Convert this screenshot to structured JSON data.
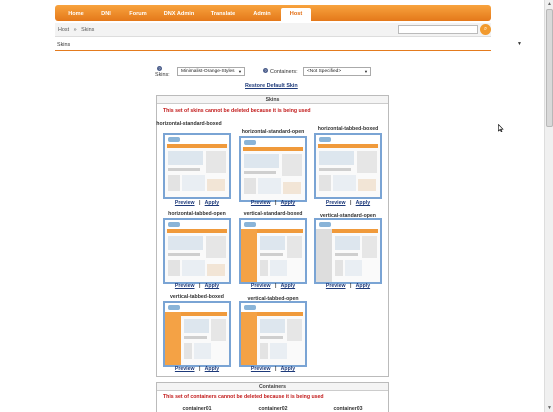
{
  "nav": {
    "tabs": [
      {
        "label": "Home"
      },
      {
        "label": "DNI"
      },
      {
        "label": "Forum"
      },
      {
        "label": "DNX Admin"
      },
      {
        "label": "Translate"
      },
      {
        "label": "Admin"
      },
      {
        "label": "Host",
        "active": true
      }
    ]
  },
  "breadcrumb": {
    "root": "Host",
    "separator": "»",
    "current": "Skins"
  },
  "search": {
    "value": "",
    "icon": "search-icon"
  },
  "module": {
    "title": "Skins",
    "collapse_icon": "chevron-down-icon"
  },
  "skins_selector": {
    "label": "Skins:",
    "value": "Minimalist-Orange-Styles",
    "help_icon": "help-icon"
  },
  "containers_selector": {
    "label": "Containers:",
    "value": "<Not Specified>",
    "help_icon": "help-icon"
  },
  "restore_label": "Restore Default Skin",
  "skins_panel": {
    "header": "Skins",
    "warning": "This set of skins cannot be deleted because it is being used",
    "items": [
      {
        "title": "horizontal-standard-boxed",
        "preview": "Preview",
        "apply": "Apply"
      },
      {
        "title": "horizontal-standard-open",
        "preview": "Preview",
        "apply": "Apply"
      },
      {
        "title": "horizontal-tabbed-boxed",
        "preview": "Preview",
        "apply": "Apply"
      },
      {
        "title": "horizontal-tabbed-open",
        "preview": "Preview",
        "apply": "Apply"
      },
      {
        "title": "vertical-standard-boxed",
        "preview": "Preview",
        "apply": "Apply"
      },
      {
        "title": "vertical-standard-open",
        "preview": "Preview",
        "apply": "Apply"
      },
      {
        "title": "vertical-tabbed-boxed",
        "preview": "Preview",
        "apply": "Apply"
      },
      {
        "title": "vertical-tabbed-open",
        "preview": "Preview",
        "apply": "Apply"
      }
    ],
    "link_separator": "|"
  },
  "containers_panel": {
    "header": "Containers",
    "warning": "This set of containers cannot be deleted because it is being used",
    "items": [
      "container01",
      "container02",
      "container03"
    ]
  },
  "colors": {
    "accent": "#e4781a",
    "link": "#1e3a7a",
    "warning": "#c21a1a",
    "thumb_border": "#7aa4d4"
  }
}
